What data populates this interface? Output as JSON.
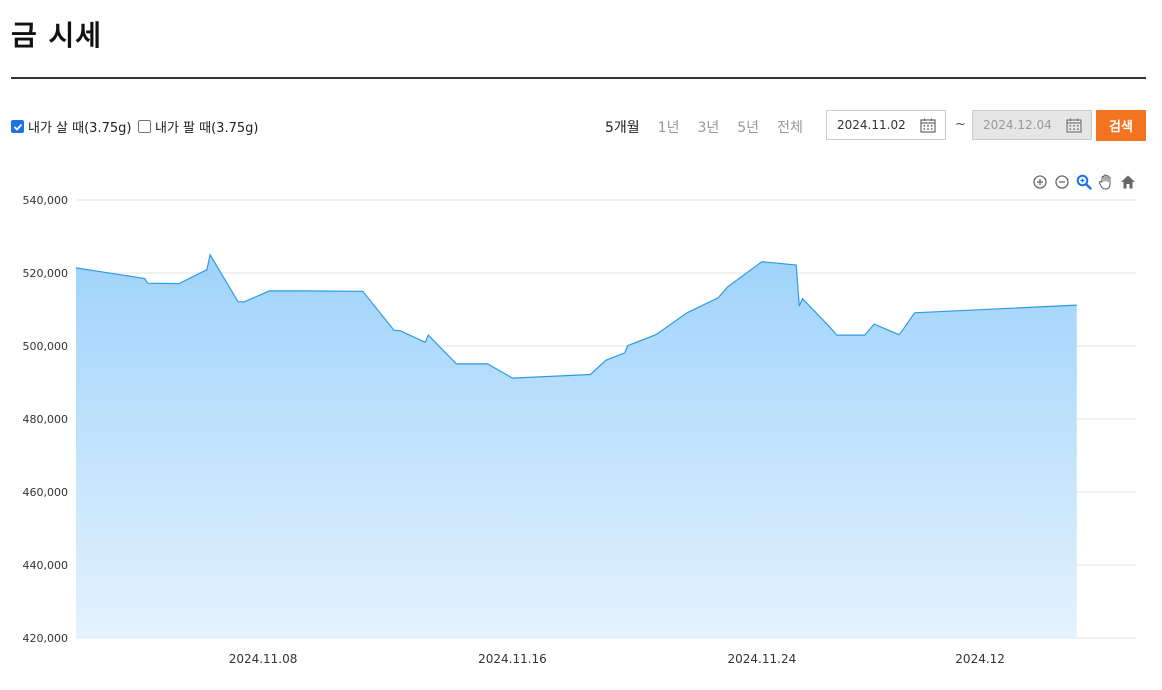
{
  "page": {
    "title": "금 시세"
  },
  "options": {
    "buy_label": "내가 살 때(3.75g)",
    "buy_checked": true,
    "sell_label": "내가 팔 때(3.75g)",
    "sell_checked": false
  },
  "periods": [
    {
      "label": "5개월",
      "active": true
    },
    {
      "label": "1년",
      "active": false
    },
    {
      "label": "3년",
      "active": false
    },
    {
      "label": "5년",
      "active": false
    },
    {
      "label": "전체",
      "active": false
    }
  ],
  "date_range": {
    "from": "2024.11.02",
    "separator": "~",
    "to": "2024.12.04"
  },
  "search_button": "검색",
  "toolbar_icons": [
    "zoom-in-icon",
    "zoom-out-icon",
    "magnifier-icon",
    "pan-hand-icon",
    "home-icon"
  ],
  "colors": {
    "area_fill": "#9fd3fb",
    "area_stroke": "#2f9be0",
    "accent": "#f47321"
  },
  "chart_data": {
    "type": "area",
    "title": "",
    "xlabel": "",
    "ylabel": "",
    "ylim": [
      420000,
      540000
    ],
    "xlim": [
      "2024-11-02",
      "2024-12-06"
    ],
    "y_ticks": [
      540000,
      520000,
      500000,
      480000,
      460000,
      440000,
      420000
    ],
    "y_tick_labels": [
      "540,000",
      "520,000",
      "500,000",
      "480,000",
      "460,000",
      "440,000",
      "420,000"
    ],
    "x_ticks": [
      "2024-11-08",
      "2024-11-16",
      "2024-11-24",
      "2024-12-01"
    ],
    "x_tick_labels": [
      "2024.11.08",
      "2024.11.16",
      "2024.11.24",
      "2024.12"
    ],
    "grid": true,
    "series": [
      {
        "x": [
          "2024-11-02",
          "2024-11-04",
          "2024-11-04",
          "2024-11-05",
          "2024-11-06",
          "2024-11-06",
          "2024-11-07",
          "2024-11-07",
          "2024-11-08",
          "2024-11-09",
          "2024-11-11",
          "2024-11-12",
          "2024-11-12",
          "2024-11-13",
          "2024-11-13",
          "2024-11-14",
          "2024-11-15",
          "2024-11-16",
          "2024-11-18",
          "2024-11-19",
          "2024-11-20",
          "2024-11-20",
          "2024-11-21",
          "2024-11-22",
          "2024-11-23",
          "2024-11-23",
          "2024-11-25",
          "2024-11-25",
          "2024-11-26",
          "2024-11-26",
          "2024-11-27",
          "2024-11-28",
          "2024-11-28",
          "2024-11-29",
          "2024-11-30",
          "2024-11-30",
          "2024-12-03",
          "2024-12-04"
        ],
        "y": [
          521400,
          518500,
          517200,
          517100,
          520900,
          525000,
          512100,
          512100,
          515100,
          515100,
          515000,
          504300,
          504200,
          501000,
          503000,
          495100,
          495100,
          491200,
          492200,
          496100,
          498100,
          500100,
          503100,
          509100,
          513200,
          516200,
          523100,
          522200,
          510900,
          513000,
          505000,
          503000,
          503000,
          506000,
          503100,
          504200,
          509100,
          511200
        ],
        "x_precise": [
          0.0,
          2.2,
          2.3,
          3.3,
          4.2,
          4.3,
          5.2,
          5.4,
          6.2,
          7.2,
          9.2,
          10.2,
          10.4,
          11.2,
          11.3,
          12.2,
          13.2,
          14.0,
          16.5,
          17.0,
          17.6,
          17.7,
          18.6,
          19.6,
          20.6,
          20.9,
          22.0,
          23.1,
          23.2,
          23.3,
          24.2,
          24.4,
          25.3,
          25.6,
          26.4,
          26.5,
          26.9,
          32.1
        ]
      }
    ]
  }
}
